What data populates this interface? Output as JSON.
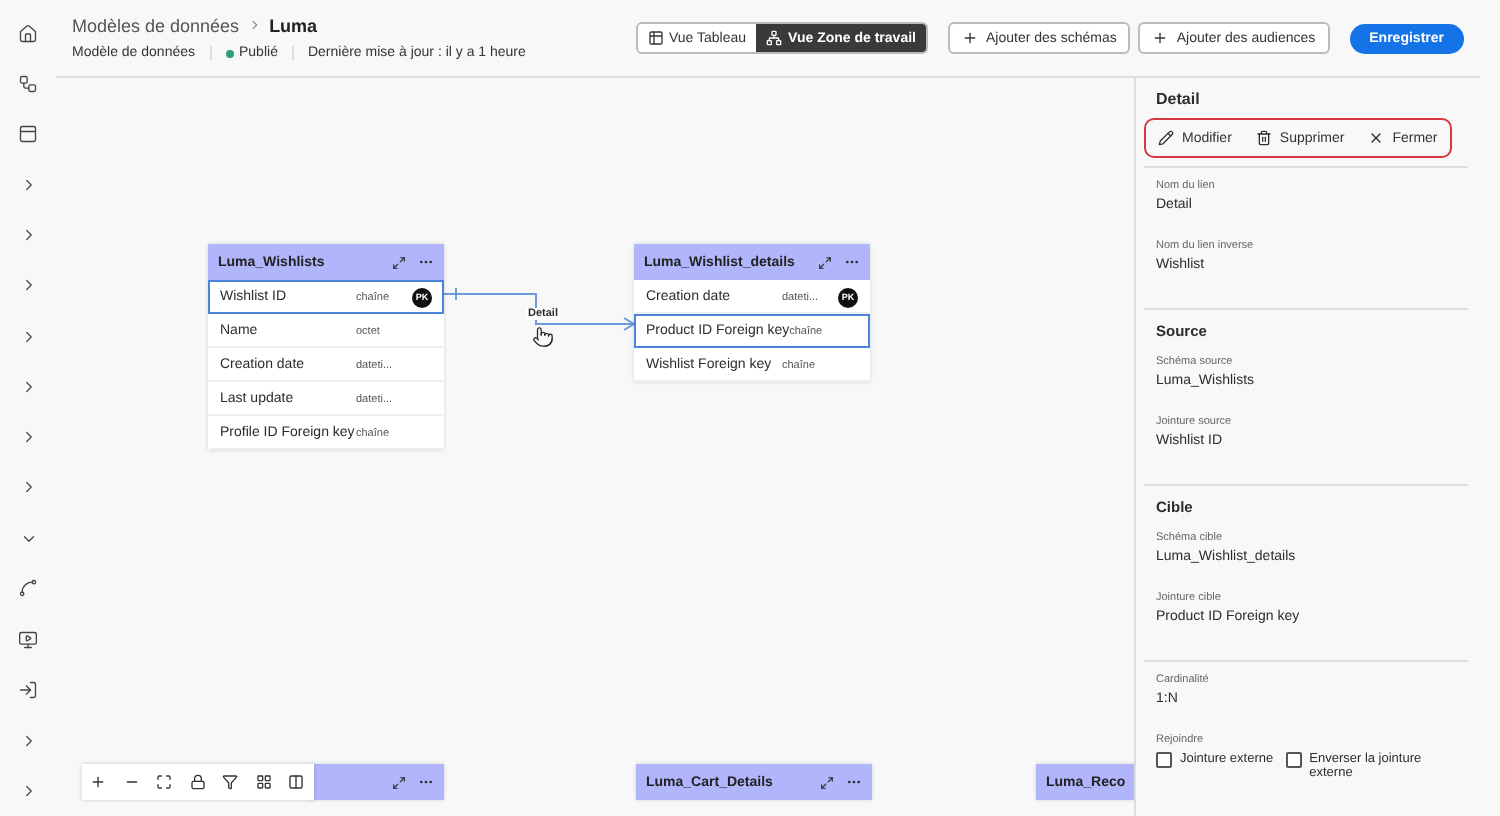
{
  "breadcrumb": {
    "parent": "Modèles de données",
    "current": "Luma"
  },
  "meta": {
    "type": "Modèle de données",
    "status": "Publié",
    "updated": "Dernière mise à jour : il y a 1 heure"
  },
  "view_toggle": [
    {
      "label": "Vue Tableau",
      "kind": "table",
      "selected": false
    },
    {
      "label": "Vue Zone de travail",
      "kind": "canvas",
      "selected": true
    }
  ],
  "actions": [
    {
      "label": "Ajouter des schémas",
      "kind": "add"
    },
    {
      "label": "Ajouter des audiences",
      "kind": "add"
    },
    {
      "label": "Enregistrer",
      "kind": "primary"
    }
  ],
  "sidebar": [
    {
      "kind": "home"
    },
    {
      "kind": "journey"
    },
    {
      "kind": "layout"
    },
    {
      "kind": "chevron"
    },
    {
      "kind": "chevron"
    },
    {
      "kind": "chevron"
    },
    {
      "kind": "chevron"
    },
    {
      "kind": "chevron"
    },
    {
      "kind": "chevron"
    },
    {
      "kind": "chevron"
    },
    {
      "kind": "expand"
    },
    {
      "kind": "link"
    },
    {
      "kind": "monitor"
    },
    {
      "kind": "login"
    },
    {
      "kind": "chevron"
    },
    {
      "kind": "chevron"
    }
  ],
  "nodes": [
    {
      "kind": "table",
      "name": "Luma_Wishlists",
      "fields": [
        {
          "name": "Wishlist ID",
          "type": "chaîne",
          "key": "PK",
          "selected": true
        },
        {
          "name": "Name",
          "type": "octet",
          "selected": false
        },
        {
          "name": "Creation date",
          "type": "dateti...",
          "selected": false
        },
        {
          "name": "Last update",
          "type": "dateti...",
          "selected": false
        },
        {
          "name": "Profile ID Foreign key",
          "type": "chaîne",
          "selected": false
        }
      ]
    },
    {
      "kind": "table",
      "name": "Luma_Wishlist_details",
      "fields": [
        {
          "name": "Creation date",
          "type": "dateti...",
          "key": "PK",
          "selected": false
        },
        {
          "name": "Product ID Foreign key",
          "type": "chaîne",
          "selected": true
        },
        {
          "name": "Wishlist Foreign key",
          "type": "chaîne",
          "selected": false
        }
      ]
    },
    {
      "kind": "table"
    },
    {
      "kind": "table",
      "name": "Luma_Cart_Details"
    },
    {
      "kind": "table",
      "name": "Luma_Reco"
    }
  ],
  "link": {
    "label": "Detail"
  },
  "zoom_toolbar": [
    {
      "kind": "plus"
    },
    {
      "kind": "minus"
    },
    {
      "kind": "fit"
    },
    {
      "kind": "lock"
    },
    {
      "kind": "filter"
    },
    {
      "kind": "layout"
    },
    {
      "kind": "columns"
    }
  ],
  "panel": {
    "title": "Detail",
    "tools": [
      {
        "label": "Modifier",
        "kind": "edit"
      },
      {
        "label": "Supprimer",
        "kind": "delete"
      },
      {
        "label": "Fermer",
        "kind": "close"
      }
    ],
    "sections": [
      {
        "fields": [
          {
            "label": "Nom du lien",
            "value": "Detail"
          },
          {
            "label": "Nom du lien inverse",
            "value": "Wishlist"
          }
        ]
      },
      {
        "title": "Source",
        "fields": [
          {
            "label": "Schéma source",
            "value": "Luma_Wishlists"
          },
          {
            "label": "Jointure source",
            "value": "Wishlist ID"
          }
        ]
      },
      {
        "title": "Cible",
        "fields": [
          {
            "label": "Schéma cible",
            "value": "Luma_Wishlist_details"
          },
          {
            "label": "Jointure cible",
            "value": "Product ID Foreign key"
          }
        ]
      },
      {
        "fields": [
          {
            "label": "Cardinalité",
            "value": "1:N"
          }
        ],
        "join": {
          "label": "Rejoindre",
          "options": [
            {
              "label": "Jointure externe",
              "checked": false
            },
            {
              "label": "Enverser la jointure externe",
              "checked": false
            }
          ]
        }
      }
    ]
  }
}
